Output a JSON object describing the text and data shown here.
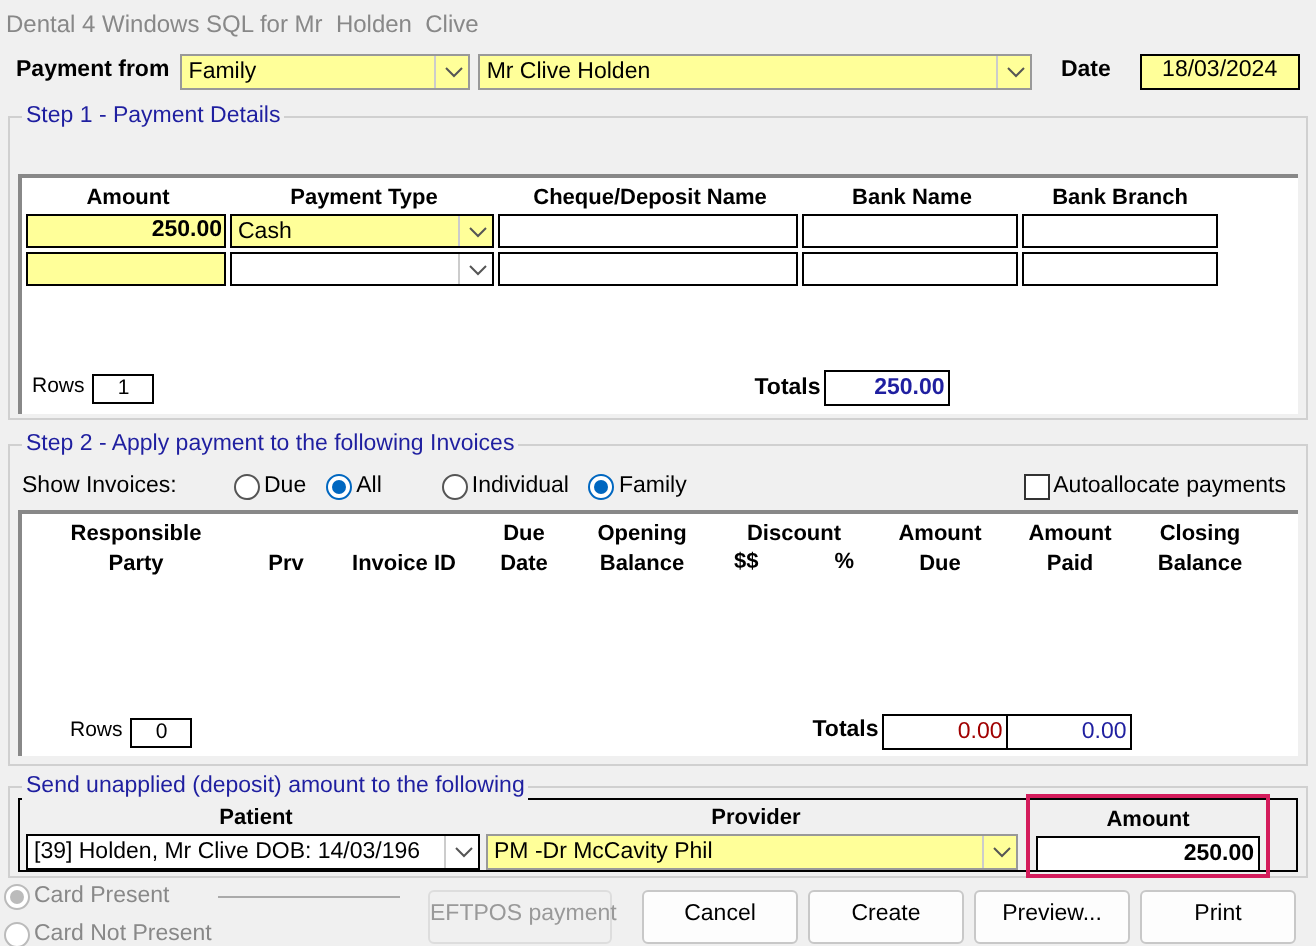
{
  "window": {
    "title": "Dental 4 Windows SQL for Mr  Holden  Clive"
  },
  "payment_from": {
    "label": "Payment from",
    "source": "Family",
    "payer": "Mr Clive  Holden",
    "date_label": "Date",
    "date": "18/03/2024"
  },
  "step1": {
    "title": "Step 1 - Payment Details",
    "columns": [
      "Amount",
      "Payment Type",
      "Cheque/Deposit Name",
      "Bank Name",
      "Bank Branch"
    ],
    "rows": [
      {
        "amount": "250.00",
        "payment_type": "Cash",
        "cheque_name": "",
        "bank_name": "",
        "bank_branch": ""
      },
      {
        "amount": "",
        "payment_type": "",
        "cheque_name": "",
        "bank_name": "",
        "bank_branch": ""
      }
    ],
    "rows_label": "Rows",
    "rows_count": "1",
    "totals_label": "Totals",
    "total": "250.00"
  },
  "step2": {
    "title": "Step 2 - Apply payment to the following Invoices",
    "show_label": "Show Invoices:",
    "filters": [
      {
        "label": "Due",
        "selected": false
      },
      {
        "label": "All",
        "selected": true
      }
    ],
    "scope": [
      {
        "label": "Individual",
        "selected": false
      },
      {
        "label": "Family",
        "selected": true
      }
    ],
    "autoallocate": {
      "label": "Autoallocate payments",
      "checked": false
    },
    "columns": [
      {
        "label": "Responsible\nParty"
      },
      {
        "label": "Prv"
      },
      {
        "label": "Invoice ID"
      },
      {
        "label": "Due\nDate"
      },
      {
        "label": "Opening\nBalance"
      },
      {
        "label": "Discount",
        "sub": [
          "$$",
          "%"
        ]
      },
      {
        "label": "Amount\nDue"
      },
      {
        "label": "Amount\nPaid"
      },
      {
        "label": "Closing\nBalance"
      }
    ],
    "rows_label": "Rows",
    "rows_count": "0",
    "totals_label": "Totals",
    "total_due": "0.00",
    "total_paid": "0.00"
  },
  "unapplied": {
    "title": "Send unapplied (deposit) amount to the following",
    "patient_label": "Patient",
    "provider_label": "Provider",
    "amount_label": "Amount",
    "patient": "[39] Holden, Mr Clive DOB: 14/03/196",
    "provider": "PM -Dr McCavity Phil",
    "amount": "250.00",
    "highlighted": true
  },
  "card_options": [
    {
      "label": "Card Present",
      "selected": true,
      "disabled": true
    },
    {
      "label": "Card Not Present",
      "selected": false,
      "disabled": true
    }
  ],
  "buttons": [
    {
      "label": "EFTPOS payment",
      "disabled": true
    },
    {
      "label": "Cancel",
      "disabled": false
    },
    {
      "label": "Create",
      "disabled": false
    },
    {
      "label": "Preview...",
      "disabled": false
    },
    {
      "label": "Print",
      "disabled": false
    }
  ]
}
